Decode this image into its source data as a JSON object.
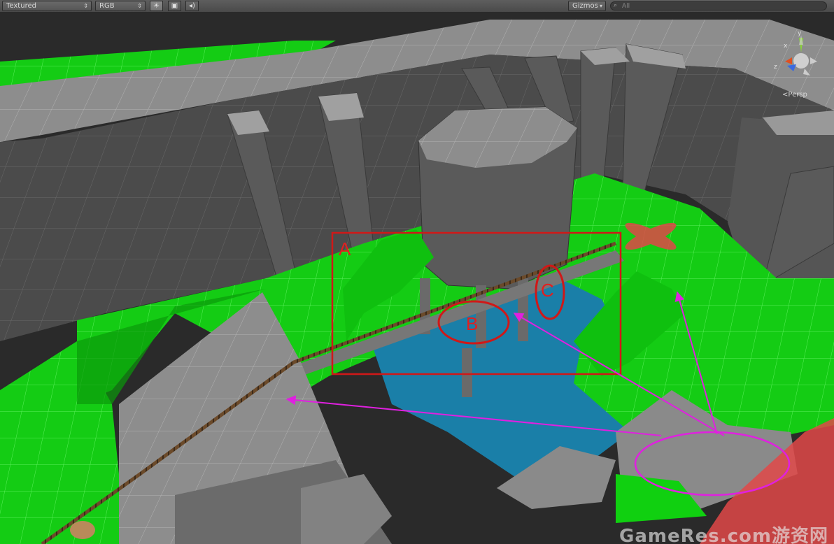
{
  "toolbar": {
    "draw_mode": "Textured",
    "color_mode": "RGB",
    "gizmos_label": "Gizmos",
    "search_placeholder": "All",
    "scene_lighting_icon": "sun-icon",
    "scene_image_icon": "image-icon",
    "audio_icon": "speaker-icon"
  },
  "viewport": {
    "projection_label": "Persp",
    "axis_labels": {
      "x": "x",
      "y": "y",
      "z": "z"
    }
  },
  "annotations": {
    "label_a": "A",
    "label_b": "B",
    "label_c": "C"
  },
  "watermark": "GameRes.com游资网",
  "colors": {
    "ground_green": "#10d010",
    "wall_gray": "#4a4a4a",
    "water_blue": "#1c7fa6",
    "annotation_red": "#d01818",
    "arrow_magenta": "#e020e0",
    "zone_red": "#e04848"
  }
}
